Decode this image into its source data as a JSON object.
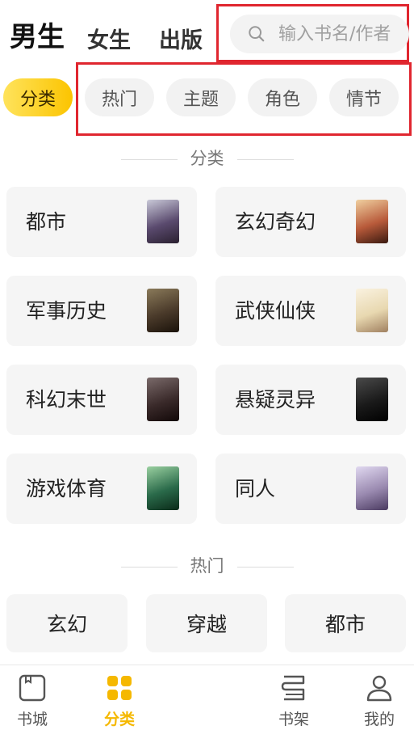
{
  "header": {
    "tabs": [
      {
        "label": "男生",
        "active": true
      },
      {
        "label": "女生",
        "active": false
      },
      {
        "label": "出版",
        "active": false
      }
    ],
    "search": {
      "placeholder": "输入书名/作者",
      "icon": "search-icon"
    }
  },
  "filters": {
    "chips": [
      {
        "label": "分类",
        "active": true
      },
      {
        "label": "热门",
        "active": false
      },
      {
        "label": "主题",
        "active": false
      },
      {
        "label": "角色",
        "active": false
      },
      {
        "label": "情节",
        "active": false
      }
    ]
  },
  "categories": {
    "title": "分类",
    "items": [
      {
        "label": "都市",
        "cover_color": "#5a4a6e"
      },
      {
        "label": "玄幻奇幻",
        "cover_color": "#b85a3a"
      },
      {
        "label": "军事历史",
        "cover_color": "#4a3a2a"
      },
      {
        "label": "武侠仙侠",
        "cover_color": "#e8d8b0"
      },
      {
        "label": "科幻末世",
        "cover_color": "#3a2a2a"
      },
      {
        "label": "悬疑灵异",
        "cover_color": "#1a1a1a"
      },
      {
        "label": "游戏体育",
        "cover_color": "#2a6a4a"
      },
      {
        "label": "同人",
        "cover_color": "#9a8ab0"
      }
    ]
  },
  "hot": {
    "title": "热门",
    "items": [
      {
        "label": "玄幻"
      },
      {
        "label": "穿越"
      },
      {
        "label": "都市"
      }
    ]
  },
  "bottom_nav": {
    "items": [
      {
        "label": "书城",
        "icon": "bookstore-icon",
        "active": false
      },
      {
        "label": "分类",
        "icon": "category-grid-icon",
        "active": true
      },
      {
        "label": "书架",
        "icon": "bookshelf-icon",
        "active": false
      },
      {
        "label": "我的",
        "icon": "profile-icon",
        "active": false
      }
    ]
  },
  "colors": {
    "accent": "#f5b800",
    "highlight_frame": "#e0262f"
  }
}
